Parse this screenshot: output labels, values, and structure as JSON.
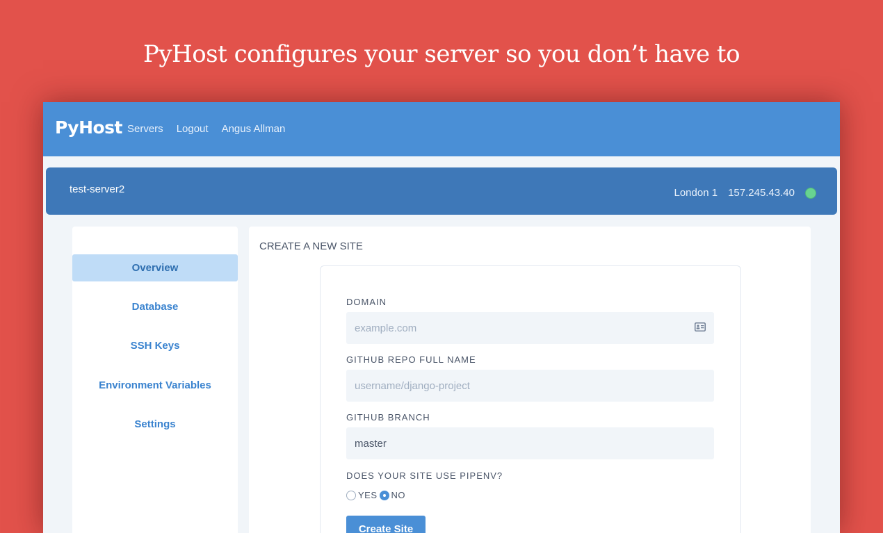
{
  "headline": "PyHost configures your server so you don’t have to",
  "navbar": {
    "brand": "PyHost",
    "links": [
      "Servers",
      "Logout",
      "Angus Allman"
    ]
  },
  "server": {
    "name": "test-server2",
    "region": "London 1",
    "ip": "157.245.43.40",
    "status_color": "#68d391"
  },
  "sidebar": {
    "items": [
      {
        "label": "Overview",
        "active": true
      },
      {
        "label": "Database"
      },
      {
        "label": "SSH Keys"
      },
      {
        "label": "Environment Variables"
      },
      {
        "label": "Settings"
      }
    ]
  },
  "form": {
    "title": "CREATE A NEW SITE",
    "domain_label": "DOMAIN",
    "domain_placeholder": "example.com",
    "domain_icon": "id-card-icon",
    "repo_label": "GITHUB REPO FULL NAME",
    "repo_placeholder": "username/django-project",
    "branch_label": "GITHUB BRANCH",
    "branch_value": "master",
    "pipenv_label": "DOES YOUR SITE USE PIPENV?",
    "pipenv_yes": "YES",
    "pipenv_no": "NO",
    "pipenv_selected": "NO",
    "submit_label": "Create Site"
  },
  "colors": {
    "background": "#e2524b",
    "navbar": "#4a8fd6",
    "server_bar": "#3e78b8",
    "accent": "#3a83cf",
    "active_item_bg": "#bfdcf7"
  }
}
